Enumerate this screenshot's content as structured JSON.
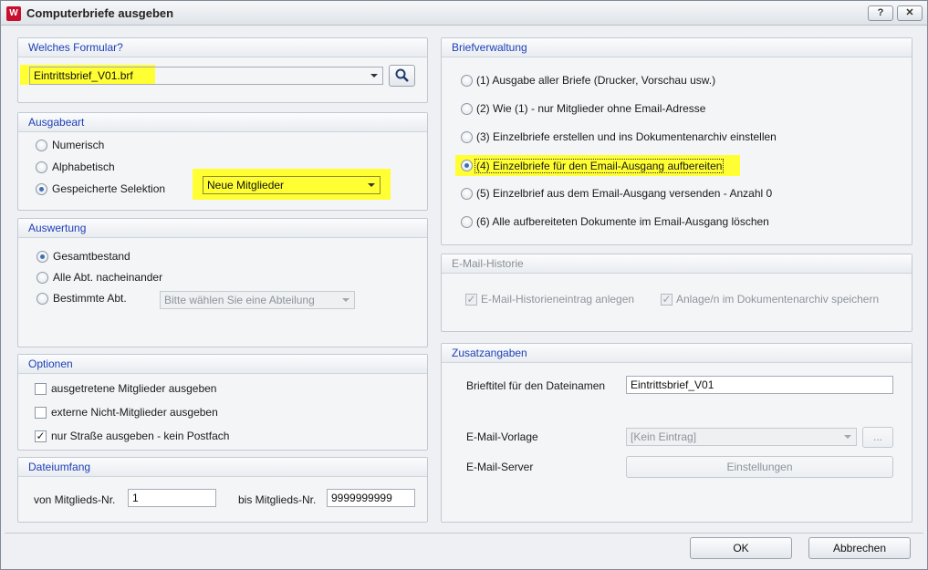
{
  "window": {
    "title": "Computerbriefe ausgeben",
    "help_label": "?",
    "close_label": "✕",
    "icon_label": "W"
  },
  "formular": {
    "heading": "Welches Formular?",
    "value": "Eintrittsbrief_V01.brf"
  },
  "ausgabeart": {
    "heading": "Ausgabeart",
    "options": [
      "Numerisch",
      "Alphabetisch",
      "Gespeicherte Selektion"
    ],
    "selected_index": 2,
    "selection_value": "Neue Mitglieder"
  },
  "auswertung": {
    "heading": "Auswertung",
    "options": [
      "Gesamtbestand",
      "Alle Abt. nacheinander",
      "Bestimmte Abt."
    ],
    "selected_index": 0,
    "abteilung_placeholder": "Bitte wählen Sie eine Abteilung"
  },
  "optionen": {
    "heading": "Optionen",
    "items": [
      {
        "label": "ausgetretene Mitglieder ausgeben",
        "checked": false
      },
      {
        "label": "externe Nicht-Mitglieder ausgeben",
        "checked": false
      },
      {
        "label": "nur Straße ausgeben - kein Postfach",
        "checked": true
      }
    ]
  },
  "dateiumfang": {
    "heading": "Dateiumfang",
    "from_label": "von Mitglieds-Nr.",
    "from_value": "1",
    "to_label": "bis Mitglieds-Nr.",
    "to_value": "9999999999"
  },
  "briefverwaltung": {
    "heading": "Briefverwaltung",
    "options": [
      "(1) Ausgabe aller Briefe (Drucker, Vorschau usw.)",
      "(2) Wie (1) - nur Mitglieder ohne Email-Adresse",
      "(3) Einzelbriefe erstellen und ins Dokumentenarchiv einstellen",
      "(4) Einzelbriefe für den Email-Ausgang aufbereiten",
      "(5) Einzelbrief aus dem Email-Ausgang versenden - Anzahl 0",
      "(6) Alle aufbereiteten Dokumente im Email-Ausgang löschen"
    ],
    "selected_index": 3
  },
  "email_historie": {
    "heading": "E-Mail-Historie",
    "items": [
      {
        "label": "E-Mail-Historieneintrag anlegen",
        "checked": true
      },
      {
        "label": "Anlage/n im Dokumentenarchiv speichern",
        "checked": true
      }
    ]
  },
  "zusatzangaben": {
    "heading": "Zusatzangaben",
    "brieftitel_label": "Brieftitel für den Dateinamen",
    "brieftitel_value": "Eintrittsbrief_V01",
    "vorlage_label": "E-Mail-Vorlage",
    "vorlage_value": "[Kein Eintrag]",
    "vorlage_button": "...",
    "server_label": "E-Mail-Server",
    "server_button": "Einstellungen"
  },
  "footer": {
    "ok_label": "OK",
    "cancel_label": "Abbrechen"
  },
  "colors": {
    "accent_heading": "#1d3fb8",
    "highlight": "#ffff33"
  }
}
